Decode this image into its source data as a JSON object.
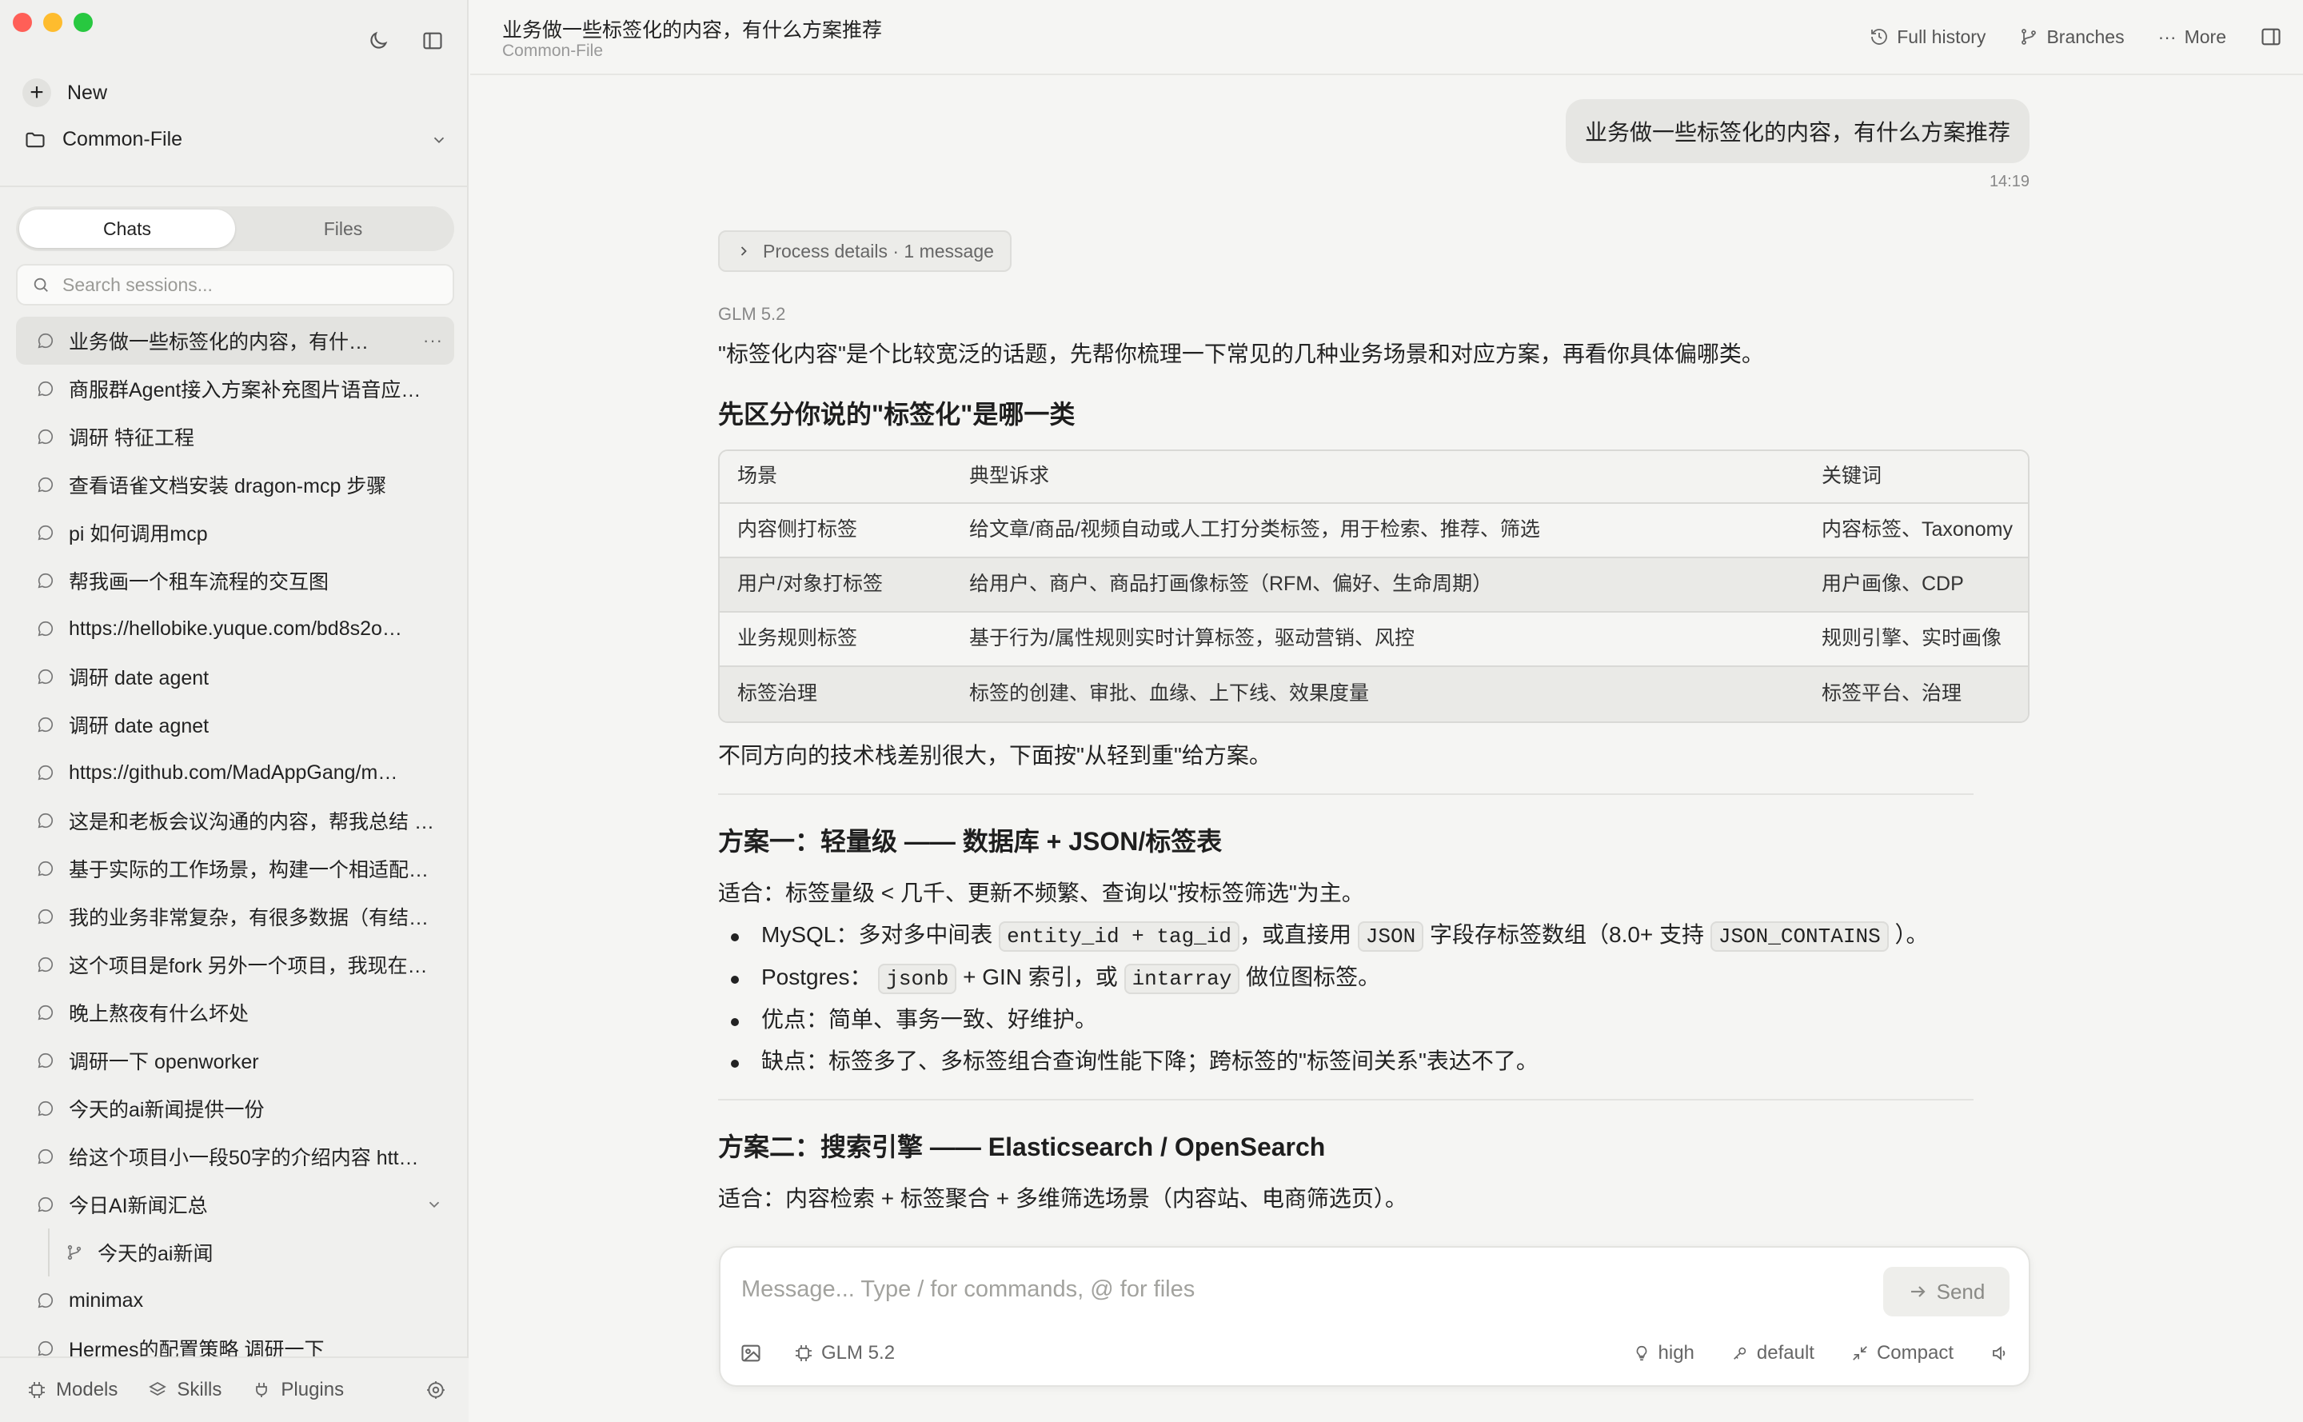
{
  "window": {
    "traffic_lights": [
      "close",
      "minimize",
      "zoom"
    ],
    "colors": {
      "close": "#ff5f57",
      "minimize": "#febc2e",
      "zoom": "#28c840"
    }
  },
  "sidebar": {
    "new_label": "New",
    "project": "Common-File",
    "tabs": [
      {
        "label": "Chats",
        "active": true
      },
      {
        "label": "Files",
        "active": false
      }
    ],
    "search_placeholder": "Search sessions...",
    "sessions": [
      "业务做一些标签化的内容，有什…",
      "商服群Agent接入方案补充图片语音应…",
      "调研 特征工程",
      "查看语雀文档安装 dragon-mcp 步骤",
      "pi 如何调用mcp",
      "帮我画一个租车流程的交互图",
      "https://hellobike.yuque.com/bd8s2o…",
      "调研 date agent",
      "调研 date agnet",
      "https://github.com/MadAppGang/m…",
      "这是和老板会议沟通的内容，帮我总结 …",
      "基于实际的工作场景，构建一个相适配…",
      "我的业务非常复杂，有很多数据（有结…",
      "这个项目是fork 另外一个项目，我现在…",
      "晚上熬夜有什么坏处",
      "调研一下 openworker",
      "今天的ai新闻提供一份",
      "给这个项目小一段50字的介绍内容 htt…",
      "今日AI新闻汇总",
      "今天的ai新闻",
      "minimax",
      "Hermes的配置策略 调研一下"
    ],
    "bottom": {
      "models": "Models",
      "skills": "Skills",
      "plugins": "Plugins"
    }
  },
  "header": {
    "title": "业务做一些标签化的内容，有什么方案推荐",
    "subtitle": "Common-File",
    "actions": {
      "history": "Full history",
      "branches": "Branches",
      "more": "More"
    }
  },
  "chat": {
    "user_message": "业务做一些标签化的内容，有什么方案推荐",
    "user_time": "14:19",
    "process_details": "Process details · 1 message",
    "model": "GLM 5.2",
    "intro": "\"标签化内容\"是个比较宽泛的话题，先帮你梳理一下常见的几种业务场景和对应方案，再看你具体偏哪类。",
    "section1_title": "先区分你说的\"标签化\"是哪一类",
    "table": {
      "headers": [
        "场景",
        "典型诉求",
        "关键词"
      ],
      "rows": [
        [
          "内容侧打标签",
          "给文章/商品/视频自动或人工打分类标签，用于检索、推荐、筛选",
          "内容标签、Taxonomy"
        ],
        [
          "用户/对象打标签",
          "给用户、商户、商品打画像标签（RFM、偏好、生命周期）",
          "用户画像、CDP"
        ],
        [
          "业务规则标签",
          "基于行为/属性规则实时计算标签，驱动营销、风控",
          "规则引擎、实时画像"
        ],
        [
          "标签治理",
          "标签的创建、审批、血缘、上下线、效果度量",
          "标签平台、治理"
        ]
      ]
    },
    "after_table": "不同方向的技术栈差别很大，下面按\"从轻到重\"给方案。",
    "plan1": {
      "title": "方案一：轻量级 —— 数据库 + JSON/标签表",
      "fit": "适合：标签量级 < 几千、更新不频繁、查询以\"按标签筛选\"为主。",
      "mysql": {
        "t1": "MySQL：多对多中间表",
        "c1": "entity_id + tag_id",
        "t2": "，或直接用",
        "c2": "JSON",
        "t3": "字段存标签数组（8.0+ 支持",
        "c3": "JSON_CONTAINS",
        "t4": "）。"
      },
      "postgres": {
        "t1": "Postgres：",
        "c1": "jsonb",
        "t2": "+ GIN 索引，或",
        "c2": "intarray",
        "t3": "做位图标签。"
      },
      "pros": "优点：简单、事务一致、好维护。",
      "cons": "缺点：标签多了、多标签组合查询性能下降；跨标签的\"标签间关系\"表达不了。"
    },
    "plan2": {
      "title": "方案二：搜索引擎 —— Elasticsearch / OpenSearch",
      "fit": "适合：内容检索 + 标签聚合 + 多维筛选场景（内容站、电商筛选页）。"
    }
  },
  "composer": {
    "placeholder": "Message... Type / for commands, @ for files",
    "send": "Send",
    "model": "GLM 5.2",
    "effort": "high",
    "mode": "default",
    "compact": "Compact"
  }
}
